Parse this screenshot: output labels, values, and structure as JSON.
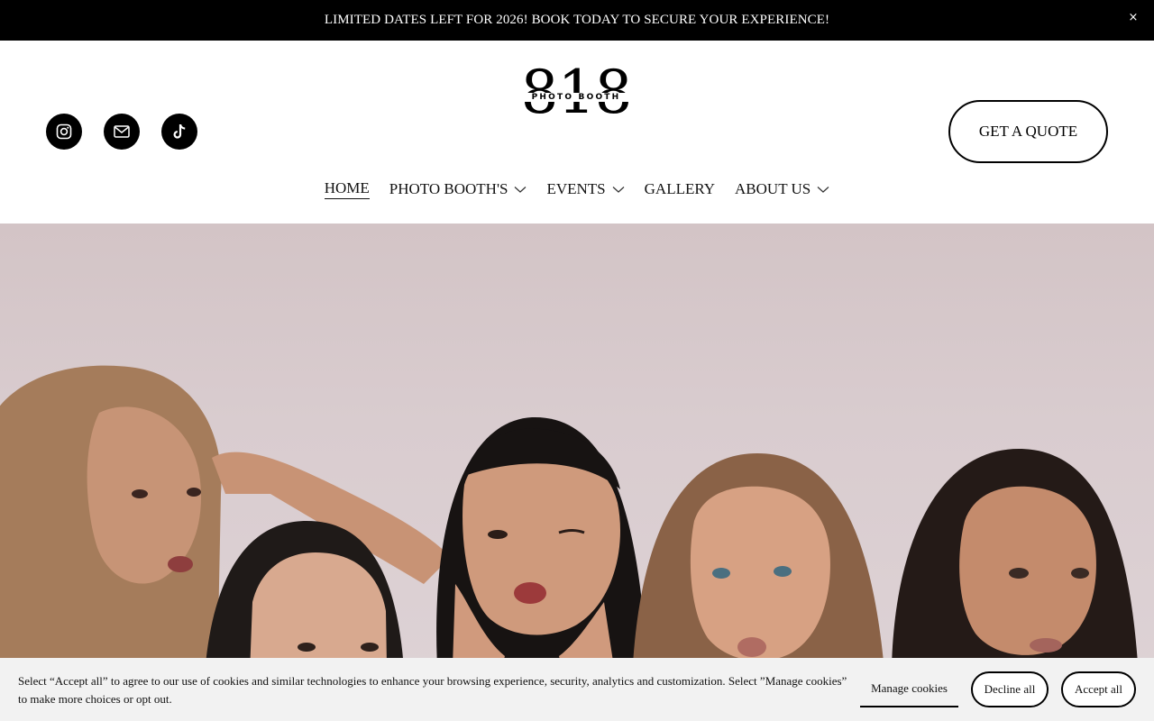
{
  "announcement": {
    "text": "LIMITED DATES LEFT FOR 2026! BOOK TODAY TO SECURE YOUR EXPERIENCE!",
    "close_label": "×"
  },
  "header": {
    "logo": {
      "number": "818",
      "subtitle": "PHOTO BOOTH"
    },
    "socials": [
      {
        "icon": "instagram-icon"
      },
      {
        "icon": "mail-icon"
      },
      {
        "icon": "tiktok-icon"
      }
    ],
    "cta_label": "GET A QUOTE"
  },
  "nav": {
    "items": [
      {
        "label": "HOME",
        "active": true,
        "dropdown": false
      },
      {
        "label": "PHOTO BOOTH'S",
        "active": false,
        "dropdown": true
      },
      {
        "label": "EVENTS",
        "active": false,
        "dropdown": true
      },
      {
        "label": "GALLERY",
        "active": false,
        "dropdown": false
      },
      {
        "label": "ABOUT US",
        "active": false,
        "dropdown": true
      }
    ]
  },
  "cookie_banner": {
    "text": "Select “Accept all” to agree to our use of cookies and similar technologies to enhance your browsing experience, security, analytics and customization. Select ”Manage cookies” to make more choices or opt out.",
    "manage_label": "Manage cookies",
    "decline_label": "Decline all",
    "accept_label": "Accept all"
  },
  "colors": {
    "announcement_bg": "#000000",
    "banner_bg": "#f2f2f2",
    "hero_backdrop": "#d6c9cb"
  }
}
